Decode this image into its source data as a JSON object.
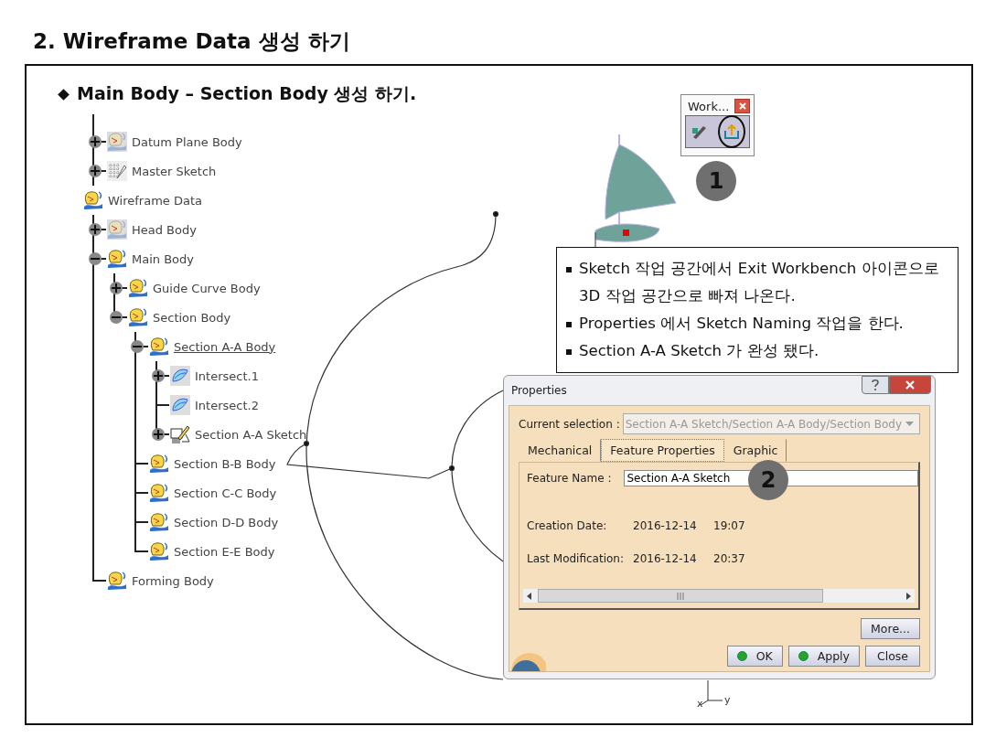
{
  "slide": {
    "title": "2. Wireframe Data 생성 하기",
    "heading": "Main Body – Section Body 생성 하기."
  },
  "tree": [
    {
      "label": "Datum Plane Body",
      "kind": "body-faded",
      "expanded": false,
      "selected": false
    },
    {
      "label": "Master Sketch",
      "kind": "sketch-grid",
      "expanded": false,
      "selected": false
    },
    {
      "label": "Wireframe Data",
      "kind": "body",
      "selected": false,
      "children": [
        {
          "label": "Head Body",
          "kind": "body-faded",
          "expanded": false,
          "selected": false
        },
        {
          "label": "Main Body",
          "kind": "body",
          "expanded": true,
          "selected": false,
          "children": [
            {
              "label": "Guide Curve Body",
              "kind": "body",
              "expanded": false,
              "selected": false
            },
            {
              "label": "Section Body",
              "kind": "body",
              "expanded": true,
              "selected": false,
              "children": [
                {
                  "label": "Section A-A Body",
                  "kind": "body",
                  "expanded": true,
                  "selected": true,
                  "children": [
                    {
                      "label": "Intersect.1",
                      "kind": "intersect",
                      "expanded": false,
                      "selected": false
                    },
                    {
                      "label": "Intersect.2",
                      "kind": "intersect",
                      "selected": false
                    },
                    {
                      "label": "Section A-A Sketch",
                      "kind": "sketch",
                      "expanded": false,
                      "selected": false
                    }
                  ]
                },
                {
                  "label": "Section B-B Body",
                  "kind": "body",
                  "selected": false
                },
                {
                  "label": "Section C-C Body",
                  "kind": "body",
                  "selected": false
                },
                {
                  "label": "Section D-D Body",
                  "kind": "body",
                  "selected": false
                },
                {
                  "label": "Section E-E Body",
                  "kind": "body",
                  "selected": false
                }
              ]
            }
          ]
        },
        {
          "label": "Forming Body",
          "kind": "body",
          "selected": false
        }
      ]
    }
  ],
  "toolbar": {
    "title": "Work...",
    "step": "1"
  },
  "note": {
    "items": [
      "Sketch 작업 공간에서 Exit Workbench 아이콘으로 3D 작업 공간으로 빠져 나온다.",
      "Properties 에서 Sketch Naming 작업을 한다.",
      "Section A-A Sketch 가 완성 됐다."
    ]
  },
  "dialog": {
    "title": "Properties",
    "selection_label": "Current selection :",
    "selection": "Section A-A Sketch/Section A-A Body/Section Body",
    "tabs": [
      {
        "label": "Mechanical",
        "selected": false
      },
      {
        "label": "Feature Properties",
        "selected": true
      },
      {
        "label": "Graphic",
        "selected": false
      }
    ],
    "name_label": "Feature Name :",
    "name": "Section A-A Sketch",
    "rows": [
      {
        "label": "Creation Date:",
        "date": "2016-12-14",
        "time": "19:07"
      },
      {
        "label": "Last Modification:",
        "date": "2016-12-14",
        "time": "20:37"
      }
    ],
    "step": "2",
    "buttons": [
      {
        "label": "More...",
        "kind": "plain"
      },
      {
        "label": "OK",
        "kind": "dot"
      },
      {
        "label": "Apply",
        "kind": "dot"
      },
      {
        "label": "Close",
        "kind": "plain"
      }
    ]
  },
  "axis": {
    "labels": [
      "x",
      "y"
    ]
  }
}
